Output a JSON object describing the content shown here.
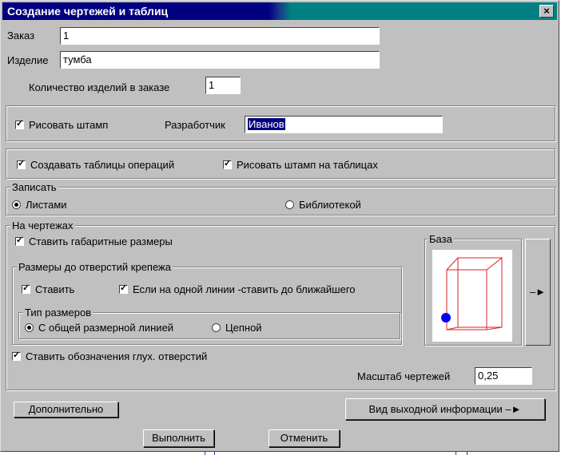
{
  "window": {
    "title": "Создание чертежей и таблиц",
    "close_label": "×"
  },
  "order": {
    "label": "Заказ",
    "value": "1"
  },
  "product": {
    "label": "Изделие",
    "value": "тумба"
  },
  "quantity": {
    "label": "Количество изделий в заказе",
    "value": "1"
  },
  "stamp": {
    "checkbox_label": "Рисовать штамп",
    "checked": true,
    "developer_label": "Разработчик",
    "developer_value": "Иванов"
  },
  "tables": {
    "create_ops_label": "Создавать таблицы операций",
    "create_ops_checked": true,
    "stamp_on_tables_label": "Рисовать штамп на таблицах",
    "stamp_on_tables_checked": true
  },
  "write": {
    "group_label": "Записать",
    "option_sheets": "Листами",
    "option_library": "Библиотекой",
    "selected": "sheets"
  },
  "drawings": {
    "group_label": "На чертежах",
    "overall_dims_label": "Ставить габаритные размеры",
    "overall_dims_checked": true,
    "fastener_group_label": "Размеры до отверстий крепежа",
    "set_label": "Ставить",
    "set_checked": true,
    "nearest_label": "Если на одной линии -ставить до ближайшего",
    "nearest_checked": true,
    "dim_type_label": "Тип размеров",
    "dim_common_label": "С общей размерной линией",
    "dim_chain_label": "Цепной",
    "dim_selected": "common",
    "blind_holes_label": "Ставить обозначения глух. отверстий",
    "blind_holes_checked": true,
    "base_label": "База",
    "base_arrow": "–►",
    "scale_label": "Масштаб чертежей",
    "scale_value": "0,25"
  },
  "buttons": {
    "additional": "Дополнительно",
    "output_view": "Вид выходной  информации  –►",
    "run": "Выполнить",
    "cancel": "Отменить"
  },
  "colors": {
    "title_start": "#000080",
    "title_end": "#008080",
    "cube_edges": "#e02020",
    "base_point": "#0000ff"
  }
}
